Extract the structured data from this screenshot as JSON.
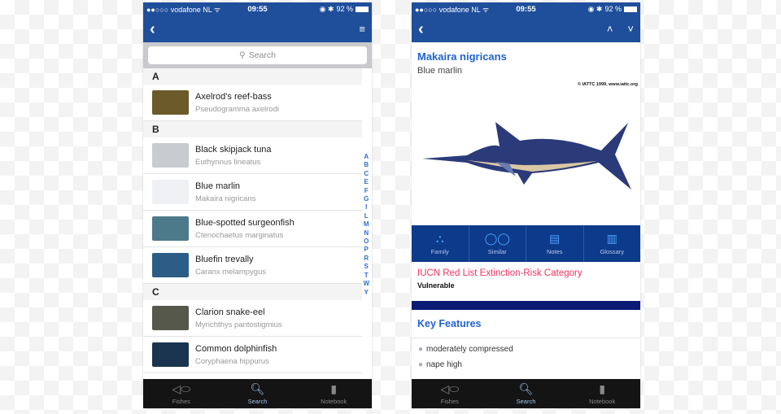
{
  "status": {
    "carrier": "vodafone NL",
    "time": "09:55",
    "battery": "92 %"
  },
  "list_screen": {
    "search_placeholder": "Search",
    "sections": [
      {
        "letter": "A",
        "items": [
          {
            "name": "Axelrod's reef-bass",
            "scientific": "Pseudogramma axelrodi",
            "thumb": "#6b5a2a"
          }
        ]
      },
      {
        "letter": "B",
        "items": [
          {
            "name": "Black skipjack tuna",
            "scientific": "Euthynnus lineatus",
            "thumb": "#c8ccd0"
          },
          {
            "name": "Blue marlin",
            "scientific": "Makaira nigricans",
            "thumb": "#eef0f4"
          },
          {
            "name": "Blue-spotted surgeonfish",
            "scientific": "Ctenochaetus marginatus",
            "thumb": "#4d7a8a"
          },
          {
            "name": "Bluefin trevally",
            "scientific": "Caranx melampygus",
            "thumb": "#2c5d86"
          }
        ]
      },
      {
        "letter": "C",
        "items": [
          {
            "name": "Clarion snake-eel",
            "scientific": "Myrichthys pantostigmius",
            "thumb": "#55584a"
          },
          {
            "name": "Common dolphinfish",
            "scientific": "Coryphaena hippurus",
            "thumb": "#1b3550"
          }
        ]
      }
    ],
    "index": [
      "A",
      "B",
      "C",
      "E",
      "F",
      "G",
      "I",
      "L",
      "M",
      "N",
      "O",
      "P",
      "R",
      "S",
      "T",
      "W",
      "Y"
    ]
  },
  "detail_screen": {
    "scientific_name": "Makaira nigricans",
    "common_name": "Blue marlin",
    "image_credit": "© IATTC 1999, www.iattc.org",
    "actions": [
      "Family",
      "Similar",
      "Notes",
      "Glossary"
    ],
    "iucn_label": "IUCN Red List Extinction-Risk Category",
    "iucn_value": "Vulnerable",
    "key_features_title": "Key Features",
    "key_features": [
      "moderately compressed",
      "nape high"
    ]
  },
  "tabbar": [
    "Fishes",
    "Search",
    "Notebook"
  ],
  "colors": {
    "header": "#1f4e9b",
    "accent": "#1f63d0",
    "iucn": "#f2335f",
    "tabbar": "#141414"
  }
}
